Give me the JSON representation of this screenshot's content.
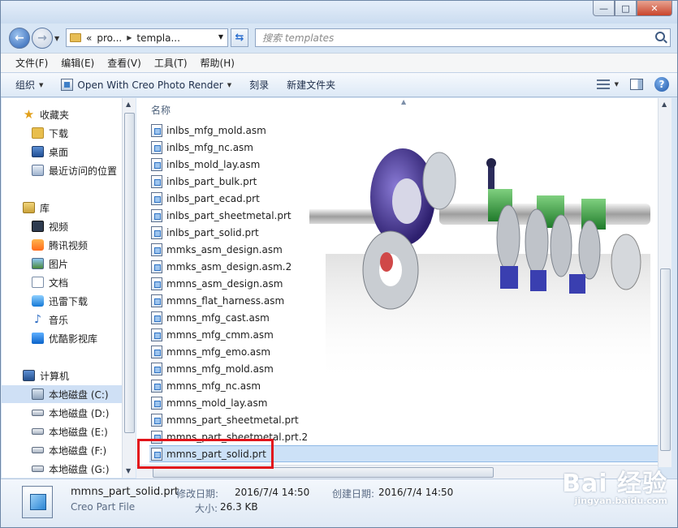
{
  "window": {
    "minimize": "—",
    "maximize": "□",
    "close": "✕"
  },
  "address": {
    "chevron": "«",
    "crumb1": "pro...",
    "crumb2": "templa...",
    "search_placeholder": "搜索 templates"
  },
  "menu": [
    "文件(F)",
    "编辑(E)",
    "查看(V)",
    "工具(T)",
    "帮助(H)"
  ],
  "toolbar": {
    "organize": "组织",
    "open_with": "Open With Creo Photo Render",
    "burn": "刻录",
    "new_folder": "新建文件夹"
  },
  "nav": {
    "favorites": "收藏夹",
    "downloads": "下载",
    "desktop": "桌面",
    "recent": "最近访问的位置",
    "libraries": "库",
    "video": "视频",
    "tencent_video": "腾讯视频",
    "pictures": "图片",
    "documents": "文档",
    "xunlei": "迅雷下载",
    "music": "音乐",
    "youku": "优酷影视库",
    "computer": "计算机",
    "drive_c": "本地磁盘 (C:)",
    "drive_d": "本地磁盘 (D:)",
    "drive_e": "本地磁盘 (E:)",
    "drive_f": "本地磁盘 (F:)",
    "drive_g": "本地磁盘 (G:)"
  },
  "filelist": {
    "column_name": "名称",
    "files": [
      "inlbs_mfg_mold.asm",
      "inlbs_mfg_nc.asm",
      "inlbs_mold_lay.asm",
      "inlbs_part_bulk.prt",
      "inlbs_part_ecad.prt",
      "inlbs_part_sheetmetal.prt",
      "inlbs_part_solid.prt",
      "mmks_asm_design.asm",
      "mmks_asm_design.asm.2",
      "mmns_asm_design.asm",
      "mmns_flat_harness.asm",
      "mmns_mfg_cast.asm",
      "mmns_mfg_cmm.asm",
      "mmns_mfg_emo.asm",
      "mmns_mfg_mold.asm",
      "mmns_mfg_nc.asm",
      "mmns_mold_lay.asm",
      "mmns_part_sheetmetal.prt",
      "mmns_part_sheetmetal.prt.2",
      "mmns_part_solid.prt"
    ],
    "selected_index": 19
  },
  "details": {
    "name": "mmns_part_solid.prt",
    "type": "Creo Part File",
    "modified_label": "修改日期:",
    "modified_value": "2016/7/4 14:50",
    "created_label": "创建日期:",
    "created_value": "2016/7/4 14:50",
    "size_label": "大小:",
    "size_value": "26.3 KB"
  },
  "watermark": {
    "main": "Bai 经验",
    "sub": "jingyan.baidu.com"
  }
}
